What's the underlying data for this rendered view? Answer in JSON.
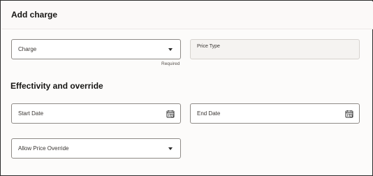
{
  "dialog": {
    "title": "Add charge"
  },
  "charge": {
    "label": "Charge",
    "helper": "Required"
  },
  "price_type": {
    "label": "Price Type"
  },
  "effectivity": {
    "title": "Effectivity and override"
  },
  "start_date": {
    "label": "Start Date"
  },
  "end_date": {
    "label": "End Date"
  },
  "allow_price_override": {
    "label": "Allow Price Override"
  },
  "icons": {
    "dropdown": "chevron-down-icon",
    "calendar": "calendar-icon"
  }
}
